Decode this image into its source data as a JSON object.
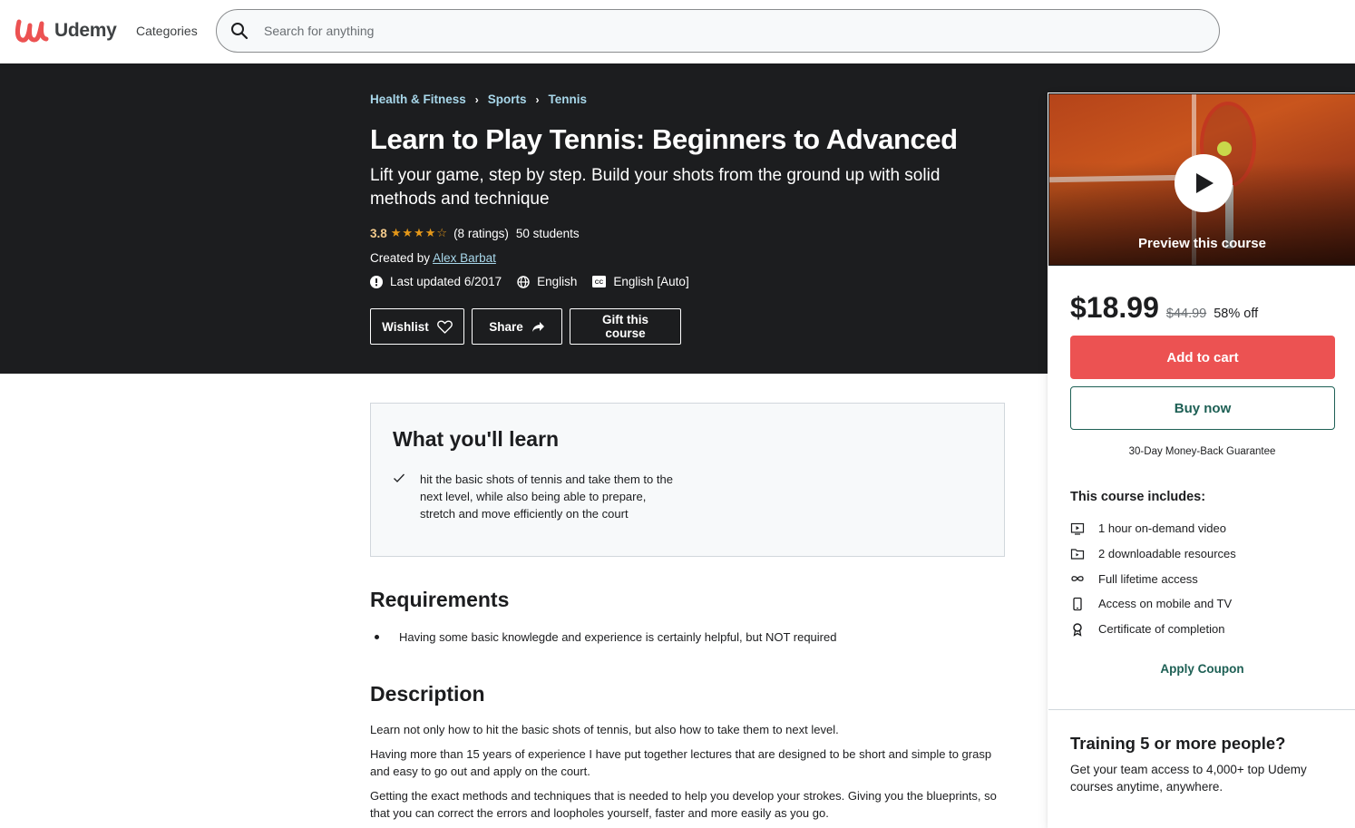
{
  "header": {
    "logo_text": "Udemy",
    "categories_label": "Categories",
    "search_placeholder": "Search for anything",
    "search_value": ""
  },
  "course": {
    "breadcrumb": [
      "Health & Fitness",
      "Sports",
      "Tennis"
    ],
    "title": "Learn to Play Tennis: Beginners to Advanced",
    "subtitle": "Lift your game, step by step. Build your shots from the ground up with solid methods and technique",
    "rating": "3.8",
    "rating_value": 3.8,
    "rating_max": 5,
    "stars_display": "★★★★☆",
    "ratings_count": "(8 ratings)",
    "students": "50 students",
    "created_by_label": "Created by",
    "instructor": "Alex Barbat",
    "last_updated": "Last updated 6/2017",
    "language": "English",
    "captions": "English [Auto]"
  },
  "actions": {
    "wishlist": "Wishlist",
    "share": "Share",
    "gift": "Gift this course"
  },
  "sidebar": {
    "preview_label": "Preview this course",
    "price": "$18.99",
    "original_price": "$44.99",
    "discount": "58% off",
    "add_to_cart": "Add to cart",
    "buy_now": "Buy now",
    "guarantee": "30-Day Money-Back Guarantee",
    "includes_title": "This course includes:",
    "includes": [
      {
        "icon": "video-icon",
        "label": "1 hour on-demand video"
      },
      {
        "icon": "file-download-icon",
        "label": "2 downloadable resources"
      },
      {
        "icon": "infinity-icon",
        "label": "Full lifetime access"
      },
      {
        "icon": "mobile-icon",
        "label": "Access on mobile and TV"
      },
      {
        "icon": "certificate-icon",
        "label": "Certificate of completion"
      }
    ],
    "apply_coupon": "Apply Coupon",
    "training_title": "Training 5 or more people?",
    "training_text": "Get your team access to 4,000+ top Udemy courses anytime, anywhere."
  },
  "learn": {
    "title": "What you'll learn",
    "items": [
      "hit the basic shots of tennis and take them to the next level, while also being able to prepare, stretch and move efficiently on the court"
    ]
  },
  "requirements": {
    "title": "Requirements",
    "items": [
      "Having some basic knowlegde and experience is certainly helpful, but NOT required"
    ]
  },
  "description": {
    "title": "Description",
    "paragraphs": [
      "Learn not only how to hit the basic shots of tennis, but also how to take them to next level.",
      "Having more than 15 years of experience I have put together lectures that are designed to be short and simple to grasp and easy to go out and apply on the court.",
      "Getting the exact methods and techniques that is needed to help you develop your strokes. Giving you the blueprints, so that you can correct the errors and loopholes yourself, faster and more easily as you go."
    ]
  },
  "colors": {
    "brand_red": "#ec5252",
    "banner_dark": "#1c1d1f",
    "link_blue": "#a8d7ea",
    "rating_orange": "#f3ca8c",
    "teal": "#1e6055"
  }
}
